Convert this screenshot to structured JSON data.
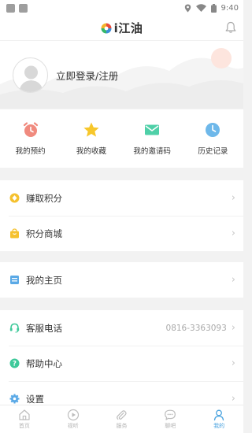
{
  "status_bar": {
    "time": "9:40"
  },
  "header": {
    "app_name": "i江油"
  },
  "profile": {
    "login_text": "立即登录/注册"
  },
  "quick_actions": [
    {
      "label": "我的预约",
      "icon": "alarm-clock-icon",
      "color": "#f08a7e"
    },
    {
      "label": "我的收藏",
      "icon": "star-icon",
      "color": "#f7c72b"
    },
    {
      "label": "我的邀请码",
      "icon": "envelope-icon",
      "color": "#4fd0a8"
    },
    {
      "label": "历史记录",
      "icon": "clock-icon",
      "color": "#6eb8ea"
    }
  ],
  "menu": {
    "earn_points": {
      "label": "赚取积分",
      "icon": "coin-icon",
      "color": "#f5c12e"
    },
    "points_mall": {
      "label": "积分商城",
      "icon": "shopping-bag-icon",
      "color": "#f5c12e"
    },
    "my_homepage": {
      "label": "我的主页",
      "icon": "homepage-icon",
      "color": "#5aa9e6"
    },
    "customer_service": {
      "label": "客服电话",
      "value": "0816-3363093",
      "icon": "headset-icon",
      "color": "#3ec99a"
    },
    "help_center": {
      "label": "帮助中心",
      "icon": "help-icon",
      "color": "#3ec99a"
    },
    "settings": {
      "label": "设置",
      "icon": "gear-icon",
      "color": "#5aa9e6"
    }
  },
  "tabbar": [
    {
      "label": "首页",
      "icon": "home-icon"
    },
    {
      "label": "视听",
      "icon": "play-icon"
    },
    {
      "label": "服务",
      "icon": "paperclip-icon"
    },
    {
      "label": "聊吧",
      "icon": "chat-icon"
    },
    {
      "label": "我的",
      "icon": "person-icon",
      "active": true
    }
  ]
}
